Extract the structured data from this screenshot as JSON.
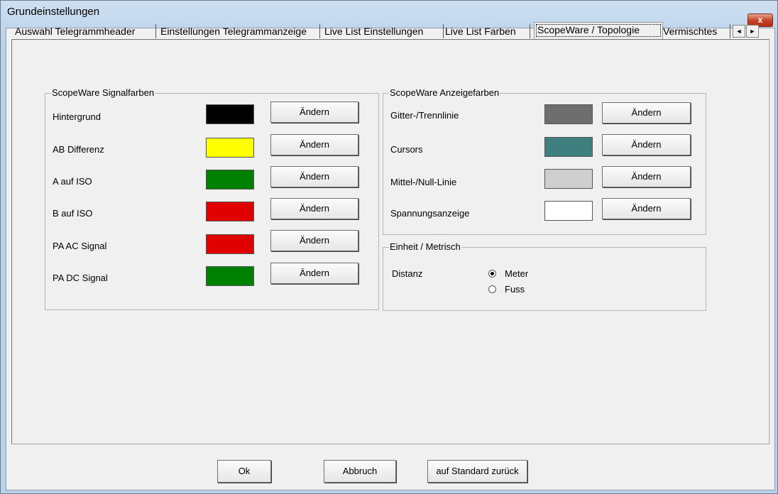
{
  "window": {
    "title": "Grundeinstellungen",
    "close_label": "x"
  },
  "tabs": [
    "Auswahl Telegrammheader",
    "Einstellungen Telegrammanzeige",
    "Live List Einstellungen",
    "Live List Farben",
    "ScopeWare / Topologie",
    "Vermischtes"
  ],
  "active_tab": "ScopeWare / Topologie",
  "tab_scroll": {
    "left": "◄",
    "right": "►"
  },
  "signal_colors": {
    "title": "ScopeWare Signalfarben",
    "rows": [
      {
        "label": "Hintergrund",
        "color": "#000000",
        "button": "Ändern"
      },
      {
        "label": "AB Differenz",
        "color": "#ffff00",
        "button": "Ändern"
      },
      {
        "label": "A auf ISO",
        "color": "#008000",
        "button": "Ändern"
      },
      {
        "label": "B auf ISO",
        "color": "#e00000",
        "button": "Ändern"
      },
      {
        "label": "PA AC Signal",
        "color": "#e00000",
        "button": "Ändern"
      },
      {
        "label": "PA DC Signal",
        "color": "#008000",
        "button": "Ändern"
      }
    ]
  },
  "display_colors": {
    "title": "ScopeWare Anzeigefarben",
    "rows": [
      {
        "label": "Gitter-/Trennlinie",
        "color": "#6e6e6e",
        "button": "Ändern"
      },
      {
        "label": "Cursors",
        "color": "#3f7f7f",
        "button": "Ändern"
      },
      {
        "label": "Mittel-/Null-Linie",
        "color": "#cfcfcf",
        "button": "Ändern"
      },
      {
        "label": "Spannungsanzeige",
        "color": "#ffffff",
        "button": "Ändern"
      }
    ]
  },
  "units": {
    "title": "Einheit / Metrisch",
    "distance_label": "Distanz",
    "options": [
      {
        "label": "Meter",
        "checked": true
      },
      {
        "label": "Fuss",
        "checked": false
      }
    ]
  },
  "footer": {
    "ok": "Ok",
    "cancel": "Abbruch",
    "reset": "auf Standard zurück"
  }
}
